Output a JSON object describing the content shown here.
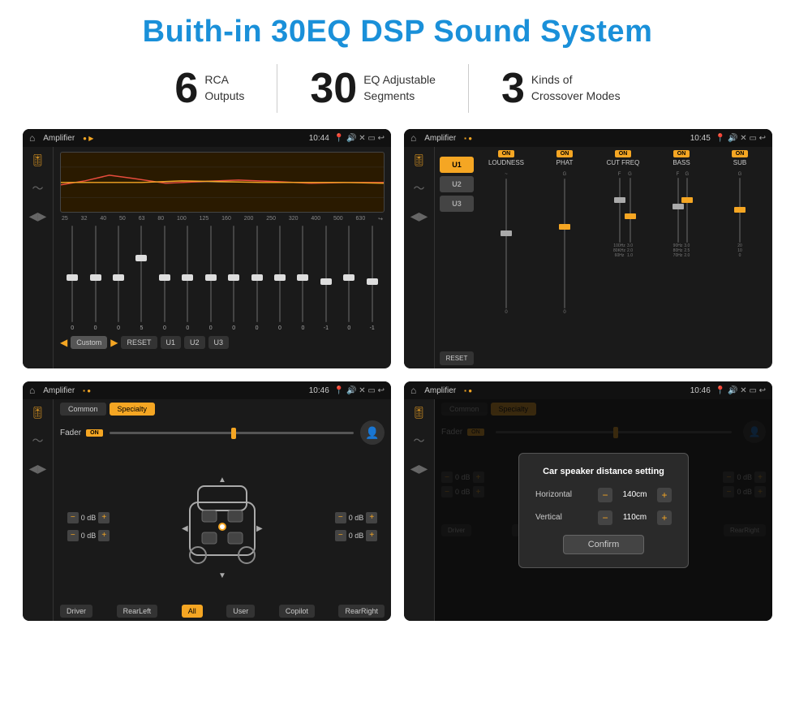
{
  "page": {
    "title": "Buith-in 30EQ DSP Sound System",
    "stats": [
      {
        "number": "6",
        "text": "RCA\nOutputs"
      },
      {
        "number": "30",
        "text": "EQ Adjustable\nSegments"
      },
      {
        "number": "3",
        "text": "Kinds of\nCrossover Modes"
      }
    ]
  },
  "screen1": {
    "status_bar": {
      "app": "Amplifier",
      "time": "10:44"
    },
    "eq_labels": [
      "25",
      "32",
      "40",
      "50",
      "63",
      "80",
      "100",
      "125",
      "160",
      "200",
      "250",
      "320",
      "400",
      "500",
      "630"
    ],
    "eq_values": [
      "0",
      "0",
      "0",
      "5",
      "0",
      "0",
      "0",
      "0",
      "0",
      "0",
      "0",
      "-1",
      "0",
      "-1"
    ],
    "nav_buttons": [
      "Custom",
      "RESET",
      "U1",
      "U2",
      "U3"
    ]
  },
  "screen2": {
    "status_bar": {
      "app": "Amplifier",
      "time": "10:45"
    },
    "u_buttons": [
      "U1",
      "U2",
      "U3"
    ],
    "channels": [
      "LOUDNESS",
      "PHAT",
      "CUT FREQ",
      "BASS",
      "SUB"
    ],
    "reset_label": "RESET"
  },
  "screen3": {
    "status_bar": {
      "app": "Amplifier",
      "time": "10:46"
    },
    "tabs": [
      "Common",
      "Specialty"
    ],
    "fader_label": "Fader",
    "on_label": "ON",
    "db_values": [
      "0 dB",
      "0 dB",
      "0 dB",
      "0 dB"
    ],
    "bottom_buttons": [
      "Driver",
      "RearLeft",
      "All",
      "User",
      "Copilot",
      "RearRight"
    ]
  },
  "screen4": {
    "status_bar": {
      "app": "Amplifier",
      "time": "10:46"
    },
    "tabs": [
      "Common",
      "Specialty"
    ],
    "modal": {
      "title": "Car speaker distance setting",
      "horizontal_label": "Horizontal",
      "horizontal_value": "140cm",
      "vertical_label": "Vertical",
      "vertical_value": "110cm",
      "confirm_label": "Confirm"
    },
    "db_values": [
      "0 dB",
      "0 dB"
    ],
    "bottom_buttons": [
      "Driver",
      "RearLeft",
      "All",
      "Copilot",
      "RearRight"
    ]
  }
}
